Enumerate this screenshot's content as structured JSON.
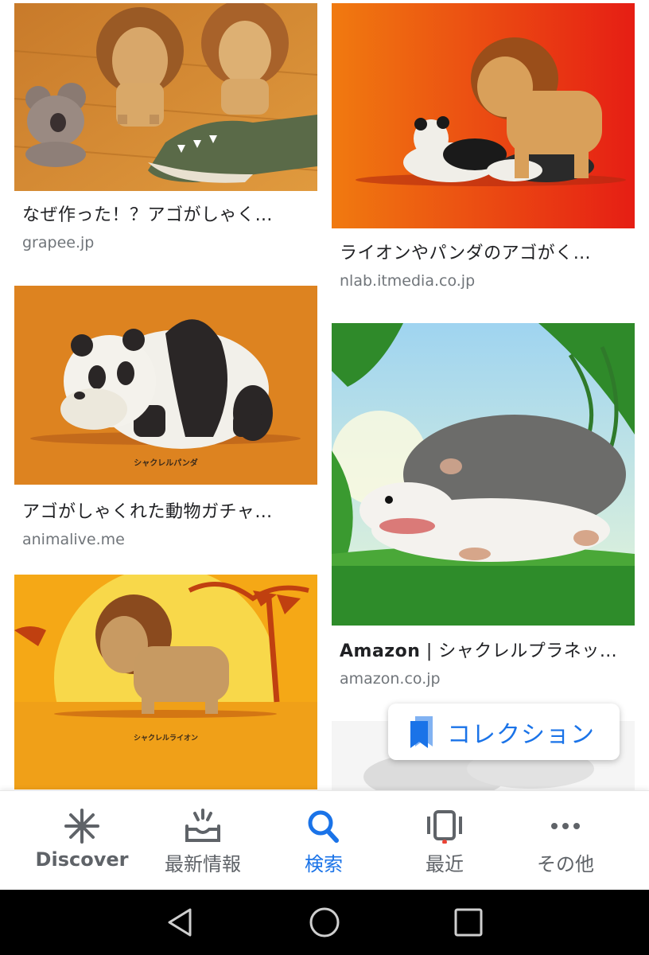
{
  "results": {
    "left": [
      {
        "title": "なぜ作った！？アゴがしゃく…",
        "source": "grapee.jp"
      },
      {
        "title": "アゴがしゃくれた動物ガチャ…",
        "source": "animalive.me",
        "image_caption": "シャクレルパンダ"
      },
      {
        "title": "",
        "source": "",
        "image_caption": "シャクレルライオン"
      }
    ],
    "right": [
      {
        "title": "ライオンやパンダのアゴがく…",
        "source": "nlab.itmedia.co.jp"
      },
      {
        "title_bold": "Amazon",
        "title": " | シャクレルプラネッ…",
        "source": "amazon.co.jp"
      }
    ]
  },
  "collection_chip": {
    "label": "コレクション",
    "icon": "bookmark-icon"
  },
  "bottom_nav": {
    "items": [
      {
        "label": "Discover",
        "icon": "asterisk-icon"
      },
      {
        "label": "最新情報",
        "icon": "updates-icon"
      },
      {
        "label": "検索",
        "icon": "search-icon",
        "active": true
      },
      {
        "label": "最近",
        "icon": "recent-icon"
      },
      {
        "label": "その他",
        "icon": "more-icon"
      }
    ]
  },
  "system_bar": {
    "buttons": [
      "back-icon",
      "home-icon",
      "overview-icon"
    ]
  },
  "colors": {
    "accent": "#1a73e8",
    "text": "#202124",
    "secondary_text": "#70757a",
    "notification_dot": "#ea4335"
  }
}
